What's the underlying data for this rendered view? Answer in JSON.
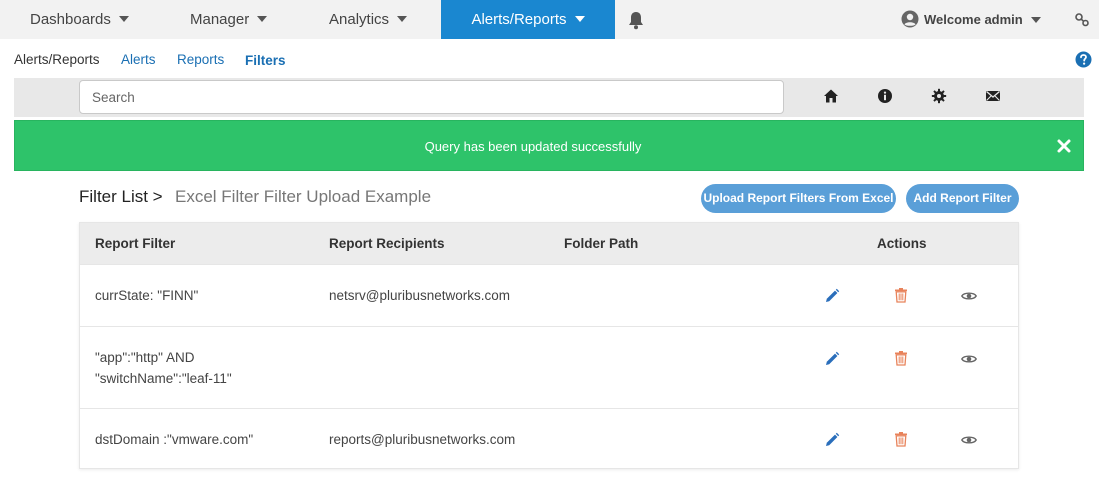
{
  "nav": {
    "dashboards": "Dashboards",
    "manager": "Manager",
    "analytics": "Analytics",
    "alerts_reports": "Alerts/Reports",
    "welcome": "Welcome admin"
  },
  "breadcrumb": {
    "root": "Alerts/Reports",
    "alerts": "Alerts",
    "reports": "Reports",
    "filters": "Filters"
  },
  "search": {
    "placeholder": "Search"
  },
  "alert": {
    "message": "Query has been updated successfully"
  },
  "list": {
    "title": "Filter List >",
    "subtitle": "Excel Filter Filter Upload Example",
    "upload_button": "Upload Report Filters From Excel",
    "add_button": "Add Report Filter"
  },
  "table": {
    "headers": {
      "filter": "Report Filter",
      "recipients": "Report Recipients",
      "folder": "Folder Path",
      "actions": "Actions"
    },
    "rows": [
      {
        "filter_line1": "currState: \"FINN\"",
        "filter_line2": "",
        "recipients": "netsrv@pluribusnetworks.com",
        "folder": ""
      },
      {
        "filter_line1": "\"app\":\"http\" AND",
        "filter_line2": "\"switchName\":\"leaf-11\"",
        "recipients": "",
        "folder": ""
      },
      {
        "filter_line1": "dstDomain :\"vmware.com\"",
        "filter_line2": "",
        "recipients": "reports@pluribusnetworks.com",
        "folder": ""
      }
    ]
  },
  "colors": {
    "primary": "#1a87d0",
    "success": "#2ec36a",
    "pill": "#5a9fd8",
    "edit": "#2a6ebb",
    "delete": "#e8835b"
  }
}
